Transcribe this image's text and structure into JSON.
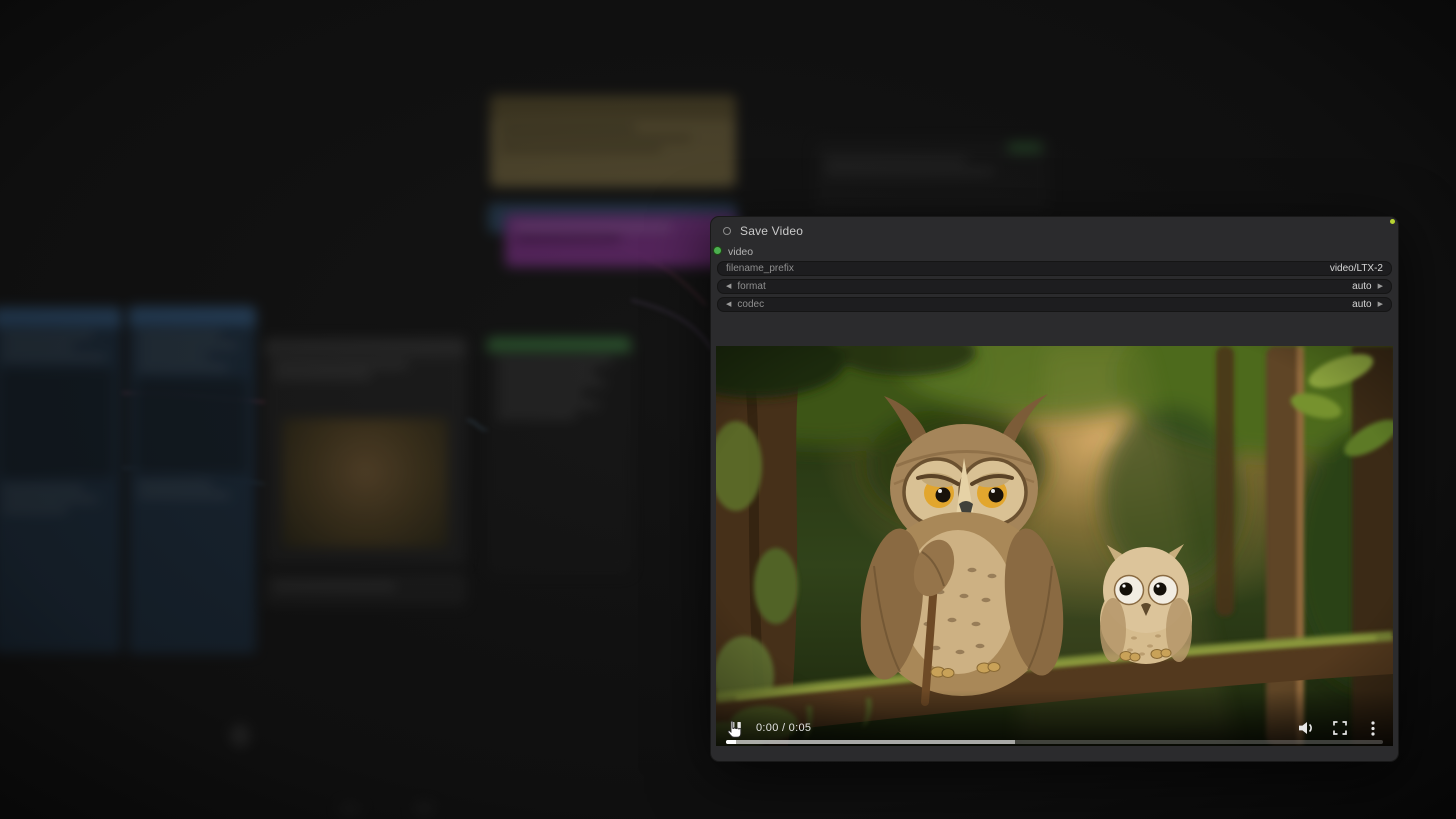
{
  "node_panel": {
    "title": "Save Video",
    "input_slot": {
      "label": "video"
    },
    "widgets": [
      {
        "type": "text",
        "label": "filename_prefix",
        "value": "video/LTX-2"
      },
      {
        "type": "combo",
        "label": "format",
        "value": "auto"
      },
      {
        "type": "combo",
        "label": "codec",
        "value": "auto"
      }
    ]
  },
  "video_player": {
    "time_display": "0:00 / 0:05",
    "progress": {
      "played_pct": 1.5,
      "buffered_pct": 44
    },
    "icons": {
      "play_pause": "pause-icon",
      "volume": "volume-icon",
      "fullscreen": "fullscreen-icon",
      "more": "kebab-menu-icon"
    }
  },
  "colors": {
    "input_slot_green": "#4caf50",
    "node_status_dot": "#b8d432",
    "panel_background": "#2b2b2d",
    "widget_background": "#1d1d1f"
  }
}
